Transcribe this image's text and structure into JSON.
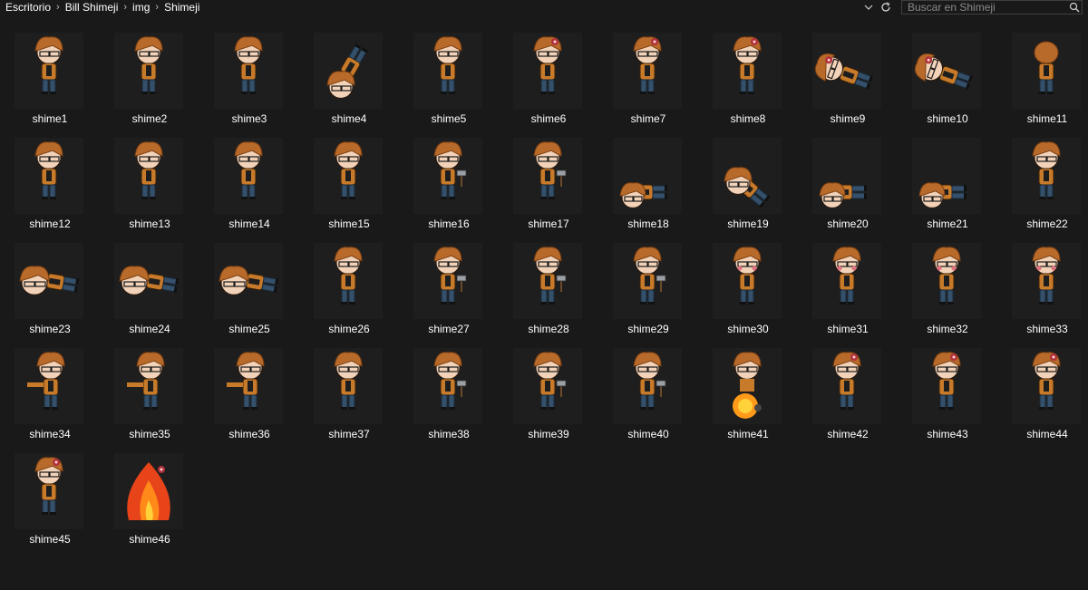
{
  "breadcrumb": [
    "Escritorio",
    "Bill Shimeji",
    "img",
    "Shimeji"
  ],
  "search": {
    "placeholder": "Buscar en Shimeji"
  },
  "files": [
    {
      "name": "shime1",
      "pose": "stand"
    },
    {
      "name": "shime2",
      "pose": "stand"
    },
    {
      "name": "shime3",
      "pose": "stand"
    },
    {
      "name": "shime4",
      "pose": "flip"
    },
    {
      "name": "shime5",
      "pose": "stand-side"
    },
    {
      "name": "shime6",
      "pose": "hurt"
    },
    {
      "name": "shime7",
      "pose": "hurt"
    },
    {
      "name": "shime8",
      "pose": "hurt"
    },
    {
      "name": "shime9",
      "pose": "fall"
    },
    {
      "name": "shime10",
      "pose": "fall"
    },
    {
      "name": "shime11",
      "pose": "back"
    },
    {
      "name": "shime12",
      "pose": "walk"
    },
    {
      "name": "shime13",
      "pose": "walk"
    },
    {
      "name": "shime14",
      "pose": "walk"
    },
    {
      "name": "shime15",
      "pose": "walk"
    },
    {
      "name": "shime16",
      "pose": "hammer"
    },
    {
      "name": "shime17",
      "pose": "hammer"
    },
    {
      "name": "shime18",
      "pose": "lie"
    },
    {
      "name": "shime19",
      "pose": "crawl"
    },
    {
      "name": "shime20",
      "pose": "lie"
    },
    {
      "name": "shime21",
      "pose": "lie"
    },
    {
      "name": "shime22",
      "pose": "stand-side"
    },
    {
      "name": "shime23",
      "pose": "climb"
    },
    {
      "name": "shime24",
      "pose": "climb"
    },
    {
      "name": "shime25",
      "pose": "climb"
    },
    {
      "name": "shime26",
      "pose": "walk"
    },
    {
      "name": "shime27",
      "pose": "hammer"
    },
    {
      "name": "shime28",
      "pose": "hammer"
    },
    {
      "name": "shime29",
      "pose": "hammer"
    },
    {
      "name": "shime30",
      "pose": "blush"
    },
    {
      "name": "shime31",
      "pose": "blush"
    },
    {
      "name": "shime32",
      "pose": "blush"
    },
    {
      "name": "shime33",
      "pose": "blush"
    },
    {
      "name": "shime34",
      "pose": "point"
    },
    {
      "name": "shime35",
      "pose": "point"
    },
    {
      "name": "shime36",
      "pose": "point"
    },
    {
      "name": "shime37",
      "pose": "walk"
    },
    {
      "name": "shime38",
      "pose": "hammer"
    },
    {
      "name": "shime39",
      "pose": "hammer"
    },
    {
      "name": "shime40",
      "pose": "hammer"
    },
    {
      "name": "shime41",
      "pose": "explode"
    },
    {
      "name": "shime42",
      "pose": "hurt"
    },
    {
      "name": "shime43",
      "pose": "hurt"
    },
    {
      "name": "shime44",
      "pose": "hurt"
    },
    {
      "name": "shime45",
      "pose": "hurt"
    },
    {
      "name": "shime46",
      "pose": "fire"
    }
  ],
  "colors": {
    "background": "#191919",
    "hair": "#b86a2a",
    "hair_dark": "#7a3f12",
    "skin": "#f2d2b8",
    "shirt": "#c77a2a",
    "pants": "#34506a",
    "fire": "#e8441a",
    "fire_inner": "#ffd23a"
  }
}
